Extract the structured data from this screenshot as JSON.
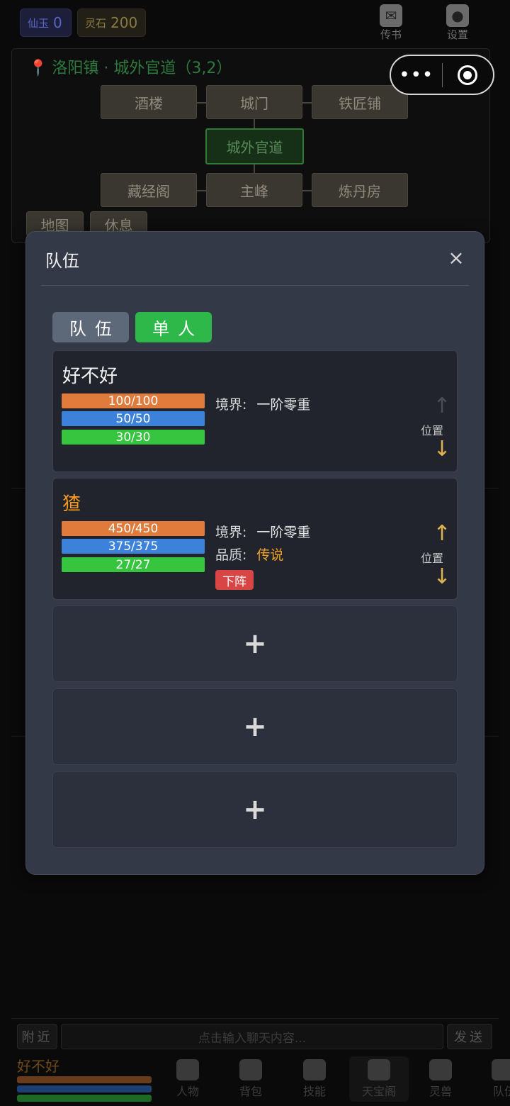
{
  "currency": {
    "jade": {
      "label": "仙玉",
      "value": "0"
    },
    "stone": {
      "label": "灵石",
      "value": "200"
    }
  },
  "top_icons": [
    {
      "label": "传书",
      "icon": "mail-icon"
    },
    {
      "label": "设置",
      "icon": "lightbulb-icon"
    }
  ],
  "capsule": {
    "more": "•••"
  },
  "map": {
    "location": "洛阳镇 · 城外官道（3,2）",
    "nodes": [
      "酒楼",
      "城门",
      "铁匠铺",
      "城外官道",
      "藏经阁",
      "主峰",
      "炼丹房"
    ],
    "buttons": [
      "地图",
      "休息"
    ]
  },
  "modal": {
    "title": "队伍",
    "close": "×",
    "tabs": [
      "队伍",
      "单人"
    ],
    "members": [
      {
        "name": "好不好",
        "hp": "100/100",
        "mp": "50/50",
        "sp": "30/30",
        "realm_label": "境界:",
        "realm": "一阶零重",
        "position_label": "位置",
        "up": "↑",
        "down": "↓"
      },
      {
        "name": "猹",
        "hp": "450/450",
        "mp": "375/375",
        "sp": "27/27",
        "realm_label": "境界:",
        "realm": "一阶零重",
        "quality_label": "品质:",
        "quality": "传说",
        "dismiss": "下阵",
        "position_label": "位置",
        "up": "↑",
        "down": "↓"
      }
    ],
    "empty_slot": "+"
  },
  "chat": {
    "channel": "附近",
    "placeholder": "点击输入聊天内容...",
    "send": "发送"
  },
  "player": {
    "name": "好不好"
  },
  "nav": [
    "人物",
    "背包",
    "技能",
    "天宝阁",
    "灵兽",
    "队伍"
  ],
  "colors": {
    "hp": "#e07b3c",
    "mp": "#3d82da",
    "sp": "#37c53f",
    "tab_active": "#2eb84a",
    "legend": "#f2a321",
    "dismiss": "#d84545"
  }
}
